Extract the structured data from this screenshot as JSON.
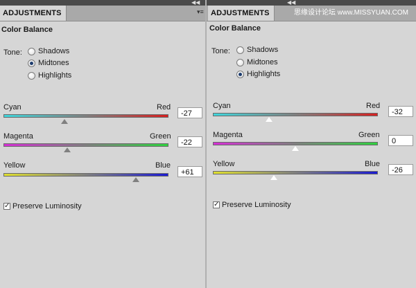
{
  "panels": [
    {
      "tab_label": "ADJUSTMENTS",
      "section_title": "Color Balance",
      "tone_label": "Tone:",
      "tones": [
        {
          "label": "Shadows",
          "selected": false
        },
        {
          "label": "Midtones",
          "selected": true
        },
        {
          "label": "Highlights",
          "selected": false
        }
      ],
      "sliders": [
        {
          "left_label": "Cyan",
          "right_label": "Red",
          "value": "-27"
        },
        {
          "left_label": "Magenta",
          "right_label": "Green",
          "value": "-22"
        },
        {
          "left_label": "Yellow",
          "right_label": "Blue",
          "value": "+61"
        }
      ],
      "preserve_label": "Preserve Luminosity",
      "preserve_checked": true
    },
    {
      "tab_label": "ADJUSTMENTS",
      "section_title": "Color Balance",
      "tone_label": "Tone:",
      "tones": [
        {
          "label": "Shadows",
          "selected": false
        },
        {
          "label": "Midtones",
          "selected": false
        },
        {
          "label": "Highlights",
          "selected": true
        }
      ],
      "sliders": [
        {
          "left_label": "Cyan",
          "right_label": "Red",
          "value": "-32"
        },
        {
          "left_label": "Magenta",
          "right_label": "Green",
          "value": "0"
        },
        {
          "left_label": "Yellow",
          "right_label": "Blue",
          "value": "-26"
        }
      ],
      "preserve_label": "Preserve Luminosity",
      "preserve_checked": true
    }
  ],
  "watermark": "思缘设计论坛 www.MISSYUAN.COM",
  "icons": {
    "collapse": "double-chevron-icon",
    "menu": "panel-menu-icon",
    "check": "checkmark-icon"
  }
}
